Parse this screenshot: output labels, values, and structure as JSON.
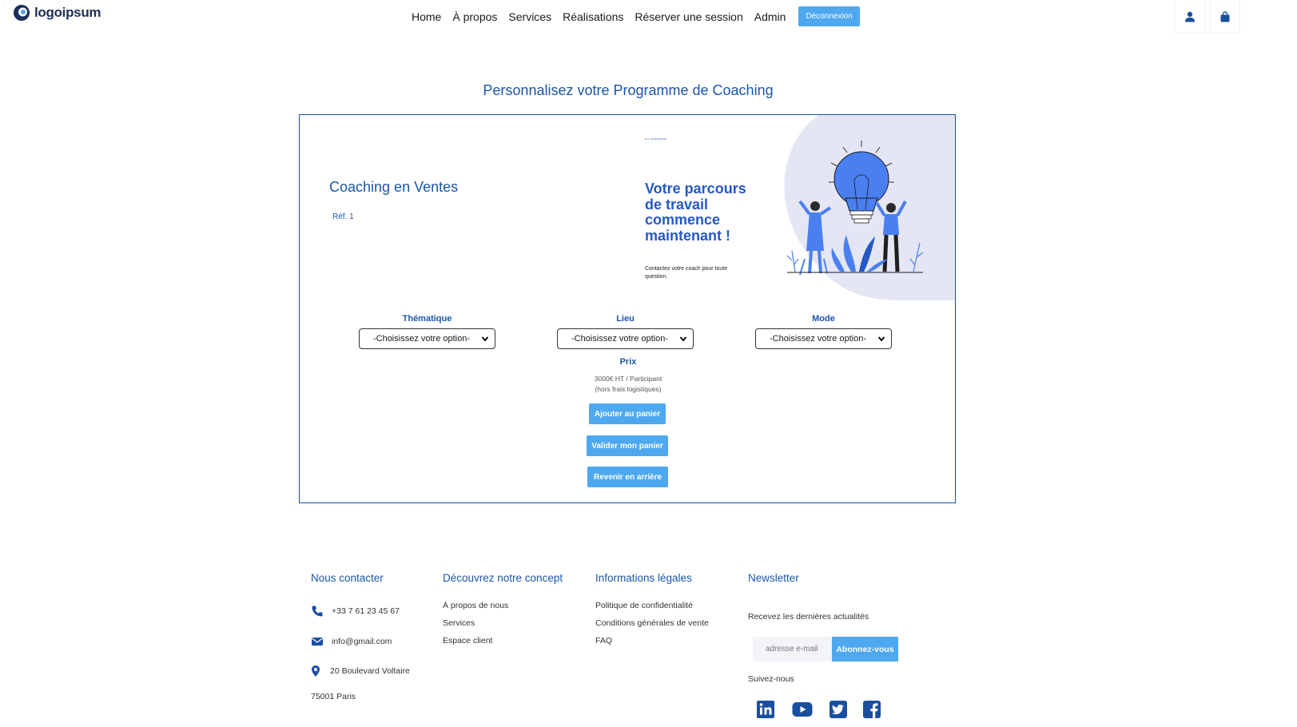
{
  "brand": {
    "name": "logoipsum",
    "color": "#1b2f59"
  },
  "nav": {
    "items": [
      "Home",
      "À propos",
      "Services",
      "Réalisations",
      "Réserver une session",
      "Admin"
    ],
    "logout_label": "Déconnexion",
    "icons": [
      "user-icon",
      "shopping-bag-icon"
    ]
  },
  "page": {
    "title": "Personnalisez votre Programme de Coaching"
  },
  "product": {
    "title": "Coaching en Ventes",
    "ref": "Réf. 1"
  },
  "banner": {
    "tiny": "ici connecté",
    "headline": "Votre parcours de travail commence maintenant !",
    "subtitle": "Contactez votre coach pour toute question."
  },
  "options": {
    "thematique": {
      "label": "Thématique",
      "value": "-Choisissez votre option-"
    },
    "lieu": {
      "label": "Lieu",
      "value": "-Choisissez votre option-"
    },
    "mode": {
      "label": "Mode",
      "value": "-Choisissez votre option-"
    }
  },
  "price": {
    "label": "Prix",
    "value": "3000€ HT / Participant",
    "note": "(hors frais logistiques)"
  },
  "actions": {
    "add_to_cart": "Ajouter au panier",
    "validate_cart": "Valider mon panier",
    "go_back": "Revenir en arrière"
  },
  "footer": {
    "contact": {
      "title": "Nous contacter",
      "phone": "+33 7 61 23 45 67",
      "email": "info@gmail.com",
      "address_line1": "20 Boulevard Voltaire",
      "address_line2": "75001 Paris"
    },
    "concept": {
      "title": "Découvrez notre concept",
      "links": [
        "À propos de nous",
        "Services",
        "Espace client"
      ]
    },
    "legal": {
      "title": "Informations légales",
      "links": [
        "Politique de confidentialité",
        "Conditions générales de vente",
        "FAQ"
      ]
    },
    "newsletter": {
      "title": "Newsletter",
      "text": "Recevez les dernières actualités",
      "placeholder": "adresse e-mail",
      "button": "Abonnez-vous",
      "follow": "Suivez-nous",
      "socials": [
        "linkedin-icon",
        "youtube-icon",
        "twitter-icon",
        "facebook-icon"
      ]
    }
  },
  "colors": {
    "primary": "#1a56a8",
    "button": "#4da8f0",
    "border": "#1a4fa0"
  }
}
